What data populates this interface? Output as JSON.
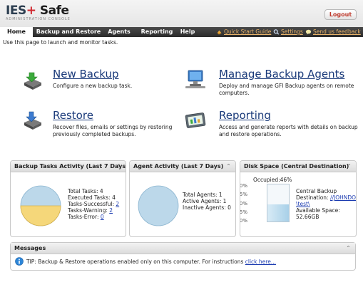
{
  "brand": {
    "name_ies": "IES",
    "name_plus": "+",
    "name_safe": " Safe",
    "subtitle": "ADMINISTRATION CONSOLE"
  },
  "header": {
    "logout_label": "Logout"
  },
  "nav": {
    "tabs": [
      {
        "label": "Home",
        "active": true
      },
      {
        "label": "Backup and Restore",
        "active": false
      },
      {
        "label": "Agents",
        "active": false
      },
      {
        "label": "Reporting",
        "active": false
      },
      {
        "label": "Help",
        "active": false
      }
    ],
    "links": {
      "quick_start": "Quick Start Guide",
      "settings": "Settings",
      "feedback": "Send us feedback"
    }
  },
  "intro": "Use this page to launch and monitor tasks.",
  "tasks": {
    "new_backup": {
      "title": "New Backup",
      "desc": "Configure a new backup task."
    },
    "manage_agents": {
      "title": "Manage Backup Agents",
      "desc_line1": "Deploy and manage GFI Backup agents on remote",
      "desc_line2": "computers."
    },
    "restore": {
      "title": "Restore",
      "desc_line1": "Recover files, emails or settings by restoring",
      "desc_line2": "previously completed backups."
    },
    "reporting": {
      "title": "Reporting",
      "desc_line1": "Access and generate reports with details on backup",
      "desc_line2": "and restore operations."
    }
  },
  "backup_activity": {
    "title": "Backup Tasks Activity (Last 7 Days)",
    "total": "Total Tasks: 4",
    "executed": "Executed Tasks: 4",
    "successful_label": "Tasks-Successful:",
    "successful_value": "2",
    "warning_label": "Tasks-Warning:",
    "warning_value": "2",
    "error_label": "Tasks-Error:",
    "error_value": "0"
  },
  "agent_activity": {
    "title": "Agent Activity (Last 7 Days)",
    "total": "Total Agents: 1",
    "active": "Active Agents: 1",
    "inactive": "Inactive Agents: 0"
  },
  "disk_space": {
    "title": "Disk Space (Central Destination)",
    "occupied": "Occupied:46%",
    "occupied_fraction": 0.46,
    "scale": [
      "100%",
      "75%",
      "50%",
      "25%",
      "0%"
    ],
    "dest_label_1": "Central Backup",
    "dest_label_2": "Destination:",
    "dest_path_1": "//JOHNDOE",
    "dest_path_2": "\\test\\",
    "available": "Available Space:",
    "available_value": "52.66GB"
  },
  "messages": {
    "title": "Messages",
    "tip": "TIP: Backup & Restore operations enabled only on this computer. For instructions",
    "link": "click here..."
  },
  "colors": {
    "nav_link": "#e8b36a",
    "title_blue": "#1a3a7a",
    "logout_red": "#c0392b",
    "pie_yellow": "#f5d77a",
    "pie_blue": "#bcd8ea"
  }
}
